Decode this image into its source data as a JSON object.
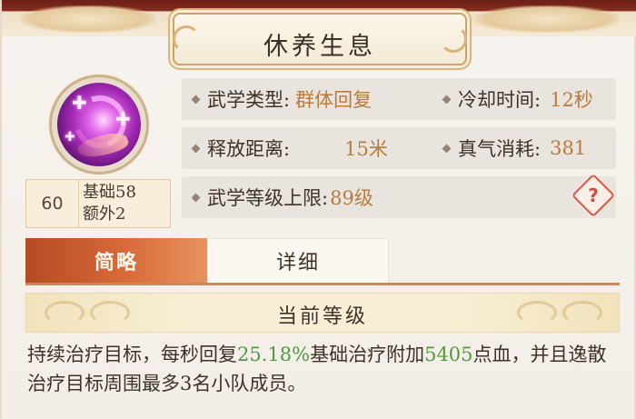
{
  "skill": {
    "name": "休养生息",
    "level": "60",
    "base_level": "基础58",
    "extra_level": "额外2"
  },
  "info": {
    "type_label": "武学类型:",
    "type_value": "群体回复",
    "cooldown_label": "冷却时间:",
    "cooldown_value": "12秒",
    "range_label": "释放距离:",
    "range_value": "15米",
    "cost_label": "真气消耗:",
    "cost_value": "381",
    "cap_label": "武学等级上限:",
    "cap_value": "89级",
    "help_glyph": "?"
  },
  "tabs": {
    "brief": "简略",
    "detail": "详细",
    "active": "简略"
  },
  "current_level": {
    "title": "当前等级",
    "desc_1": "持续治疗目标，每秒回复",
    "desc_pct": "25.18%",
    "desc_2": "基础治疗附加",
    "desc_num": "5405",
    "desc_3": "点血，并且逸散治疗目标周围最多3名小队成员。"
  },
  "colors": {
    "value_text": "#b77c3d",
    "highlight_green": "#4f9a3a",
    "active_tab": "#c65a2c",
    "help_red": "#d24b3b"
  },
  "icons": {
    "skill_icon": "healing-swirl-icon",
    "help_icon": "question-diamond-icon",
    "bullet_icon": "diamond-bullet-icon"
  }
}
